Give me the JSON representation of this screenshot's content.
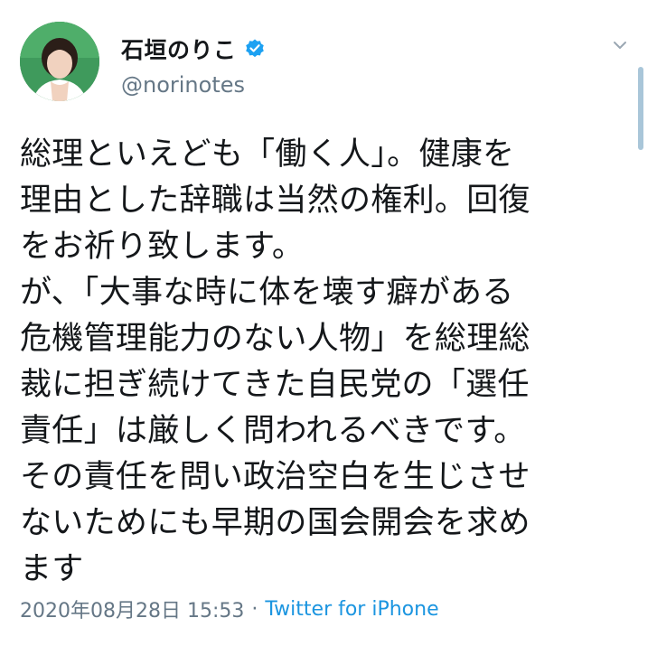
{
  "tweet": {
    "author": {
      "display_name": "石垣のりこ",
      "handle": "@norinotes",
      "verified": true,
      "avatar_icon": "profile-photo"
    },
    "menu_icon": "chevron-down-icon",
    "text_lines": [
      "総理といえども「働く人」。健康を",
      "理由とした辞職は当然の権利。回復",
      "をお祈り致します。",
      "が、「大事な時に体を壊す癖がある",
      "危機管理能力のない人物」を総理総",
      "裁に担ぎ続けてきた自民党の「選任",
      "責任」は厳しく問われるべきです。",
      "その責任を問い政治空白を生じさせ",
      "ないためにも早期の国会開会を求め",
      "ます"
    ],
    "timestamp": "2020年08月28日 15:53",
    "separator": "·",
    "source": "Twitter for iPhone"
  },
  "colors": {
    "text": "#14171a",
    "secondary": "#657786",
    "link": "#1b95e0",
    "verified": "#1da1f2"
  }
}
